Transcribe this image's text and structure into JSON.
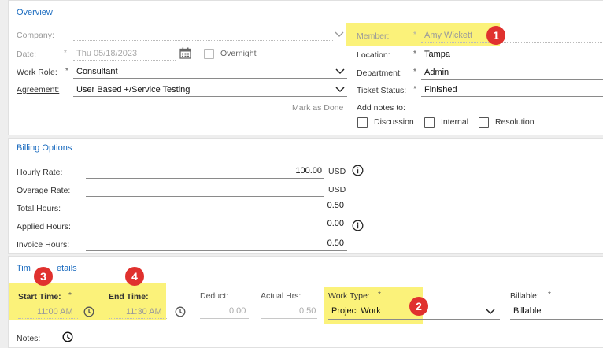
{
  "overview": {
    "title": "Overview",
    "company_label": "Company:",
    "date_label": "Date:",
    "date_value": "Thu 05/18/2023",
    "overnight_label": "Overnight",
    "work_role_label": "Work Role:",
    "work_role_value": "Consultant",
    "agreement_label": "Agreement:",
    "agreement_value": "User Based +/Service Testing",
    "member_label": "Member:",
    "member_value": "Amy Wickett",
    "location_label": "Location:",
    "location_value": "Tampa",
    "department_label": "Department:",
    "department_value": "Admin",
    "ticket_status_label": "Ticket Status:",
    "ticket_status_value": "Finished",
    "mark_as_done": "Mark as Done",
    "add_notes_label": "Add notes to:",
    "notes_options": [
      "Discussion",
      "Internal",
      "Resolution"
    ],
    "required_mark": "*"
  },
  "billing": {
    "title": "Billing Options",
    "hourly_rate_label": "Hourly Rate:",
    "hourly_rate_value": "100.00",
    "hourly_rate_currency": "USD",
    "overage_rate_label": "Overage Rate:",
    "overage_rate_currency": "USD",
    "total_hours_label": "Total Hours:",
    "total_hours_value": "0.50",
    "applied_hours_label": "Applied Hours:",
    "applied_hours_value": "0.00",
    "invoice_hours_label": "Invoice Hours:",
    "invoice_hours_value": "0.50"
  },
  "time": {
    "title_left": "Tim",
    "title_right": "etails",
    "start_time_label": "Start Time:",
    "start_time_value": "11:00 AM",
    "end_time_label": "End Time:",
    "end_time_value": "11:30 AM",
    "deduct_label": "Deduct:",
    "deduct_value": "0.00",
    "actual_hrs_label": "Actual Hrs:",
    "actual_hrs_value": "0.50",
    "work_type_label": "Work Type:",
    "work_type_value": "Project Work",
    "billable_label": "Billable:",
    "billable_value": "Billable",
    "notes_label": "Notes:"
  },
  "annotations": [
    "1",
    "2",
    "3",
    "4"
  ],
  "colors": {
    "highlight": "#fbf27a",
    "badge": "#e0312e",
    "section_title": "#1a6bbf"
  }
}
